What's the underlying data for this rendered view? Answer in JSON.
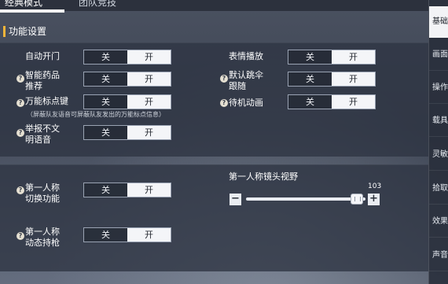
{
  "tabs": [
    {
      "label": "经典模式",
      "active": true
    },
    {
      "label": "团队竞技",
      "active": false
    }
  ],
  "section": {
    "title": "功能设置"
  },
  "toggle_labels": {
    "off": "关",
    "on": "开"
  },
  "settings": {
    "auto_door": {
      "label": "自动开门",
      "value": "on"
    },
    "smart_medicine": {
      "label_line1": "智能药品",
      "label_line2": "推荐",
      "value": "on"
    },
    "universal_mark": {
      "label": "万能标点键",
      "value": "on"
    },
    "universal_mark_hint": "（屏蔽队友语音可屏蔽队友发出的万能标点信息）",
    "report_voice": {
      "label_line1": "举报不文",
      "label_line2": "明语音",
      "value": "on"
    },
    "emote_play": {
      "label": "表情播放",
      "value": "on"
    },
    "follow_parachute": {
      "label_line1": "默认跳伞",
      "label_line2": "跟随",
      "value": "on"
    },
    "idle_animation": {
      "label": "待机动画",
      "value": "on"
    },
    "first_person_switch": {
      "label_line1": "第一人称",
      "label_line2": "切换功能",
      "value": "on"
    },
    "first_person_dynamic": {
      "label_line1": "第一人称",
      "label_line2": "动态持枪",
      "value": "on"
    }
  },
  "fov": {
    "label": "第一人称镜头视野",
    "value": "103",
    "minus": "−",
    "plus": "+",
    "fill_fraction": 0.93
  },
  "help_glyph": "?",
  "sidebar": [
    {
      "label": "基础设置",
      "active": true
    },
    {
      "label": "画面设置",
      "active": false
    },
    {
      "label": "操作设置",
      "active": false
    },
    {
      "label": "载具设置",
      "active": false
    },
    {
      "label": "灵敏度",
      "active": false
    },
    {
      "label": "拾取设置",
      "active": false
    },
    {
      "label": "效果设置",
      "active": false
    },
    {
      "label": "声音设置",
      "active": false
    }
  ]
}
